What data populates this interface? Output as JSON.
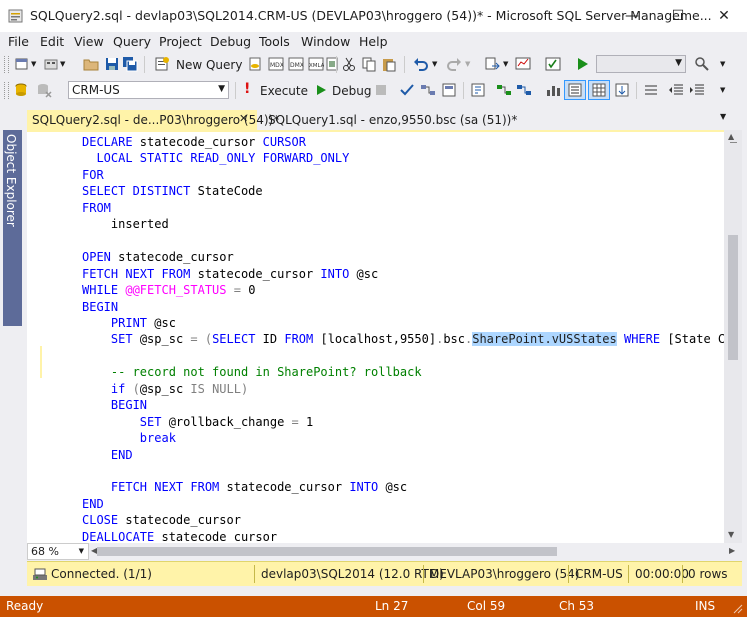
{
  "window": {
    "title": "SQLQuery2.sql - devlap03\\SQL2014.CRM-US (DEVLAP03\\hroggero (54))* - Microsoft SQL Server Manageme..."
  },
  "menu": [
    "File",
    "Edit",
    "View",
    "Query",
    "Project",
    "Debug",
    "Tools",
    "Window",
    "Help"
  ],
  "toolbar1": {
    "new_query_label": "New Query"
  },
  "toolbar2": {
    "database": "CRM-US",
    "execute_label": "Execute",
    "debug_label": "Debug"
  },
  "tabs": [
    {
      "label": "SQLQuery2.sql - de...P03\\hroggero (54))*",
      "active": true
    },
    {
      "label": "SQLQuery1.sql - enzo,9550.bsc (sa (51))*",
      "active": false
    }
  ],
  "side_panel": {
    "label": "Object Explorer"
  },
  "code": [
    [
      [
        "kw",
        "DECLARE"
      ],
      [
        "tx",
        " statecode_cursor "
      ],
      [
        "kw",
        "CURSOR"
      ]
    ],
    [
      [
        "tx",
        "  "
      ],
      [
        "kw",
        "LOCAL STATIC READ_ONLY FORWARD_ONLY"
      ]
    ],
    [
      [
        "kw",
        "FOR"
      ]
    ],
    [
      [
        "kw",
        "SELECT DISTINCT"
      ],
      [
        "tx",
        " StateCode"
      ]
    ],
    [
      [
        "kw",
        "FROM"
      ]
    ],
    [
      [
        "tx",
        "    inserted"
      ]
    ],
    [
      [
        "tx",
        ""
      ]
    ],
    [
      [
        "kw",
        "OPEN"
      ],
      [
        "tx",
        " statecode_cursor"
      ]
    ],
    [
      [
        "kw",
        "FETCH NEXT FROM"
      ],
      [
        "tx",
        " statecode_cursor "
      ],
      [
        "kw",
        "INTO"
      ],
      [
        "tx",
        " @sc"
      ]
    ],
    [
      [
        "kw",
        "WHILE"
      ],
      [
        "tx",
        " "
      ],
      [
        "mg",
        "@@FETCH_STATUS"
      ],
      [
        "tx",
        " "
      ],
      [
        "gy",
        "="
      ],
      [
        "tx",
        " 0"
      ]
    ],
    [
      [
        "kw",
        "BEGIN"
      ]
    ],
    [
      [
        "tx",
        "    "
      ],
      [
        "kw",
        "PRINT"
      ],
      [
        "tx",
        " @sc"
      ]
    ],
    [
      [
        "tx",
        "    "
      ],
      [
        "kw",
        "SET"
      ],
      [
        "tx",
        " @sp_sc "
      ],
      [
        "gy",
        "= ("
      ],
      [
        "kw",
        "SELECT"
      ],
      [
        "tx",
        " ID "
      ],
      [
        "kw",
        "FROM"
      ],
      [
        "tx",
        " [localhost,9550]"
      ],
      [
        "gy",
        "."
      ],
      [
        "tx",
        "bsc"
      ],
      [
        "gy",
        "."
      ],
      [
        "hl",
        "SharePoint.vUSStates"
      ],
      [
        "tx",
        " "
      ],
      [
        "kw",
        "WHERE"
      ],
      [
        "tx",
        " [State Co"
      ]
    ],
    [
      [
        "tx",
        ""
      ]
    ],
    [
      [
        "tx",
        "    "
      ],
      [
        "cm",
        "-- record not found in SharePoint? rollback"
      ]
    ],
    [
      [
        "tx",
        "    "
      ],
      [
        "kw",
        "if"
      ],
      [
        "tx",
        " "
      ],
      [
        "gy",
        "("
      ],
      [
        "tx",
        "@sp_sc "
      ],
      [
        "gy",
        "IS NULL)"
      ]
    ],
    [
      [
        "tx",
        "    "
      ],
      [
        "kw",
        "BEGIN"
      ]
    ],
    [
      [
        "tx",
        "        "
      ],
      [
        "kw",
        "SET"
      ],
      [
        "tx",
        " @rollback_change "
      ],
      [
        "gy",
        "="
      ],
      [
        "tx",
        " 1"
      ]
    ],
    [
      [
        "tx",
        "        "
      ],
      [
        "kw",
        "break"
      ]
    ],
    [
      [
        "tx",
        "    "
      ],
      [
        "kw",
        "END"
      ]
    ],
    [
      [
        "tx",
        ""
      ]
    ],
    [
      [
        "tx",
        "    "
      ],
      [
        "kw",
        "FETCH NEXT FROM"
      ],
      [
        "tx",
        " statecode_cursor "
      ],
      [
        "kw",
        "INTO"
      ],
      [
        "tx",
        " @sc"
      ]
    ],
    [
      [
        "kw",
        "END"
      ]
    ],
    [
      [
        "kw",
        "CLOSE"
      ],
      [
        "tx",
        " statecode_cursor"
      ]
    ],
    [
      [
        "kw",
        "DEALLOCATE"
      ],
      [
        "tx",
        " statecode_cursor"
      ]
    ]
  ],
  "zoom": "68 %",
  "query_status": {
    "connection": "Connected. (1/1)",
    "server": "devlap03\\SQL2014 (12.0 RTM)",
    "user": "DEVLAP03\\hroggero (54)",
    "database": "CRM-US",
    "elapsed": "00:00:00",
    "rows": "0 rows"
  },
  "status": {
    "state": "Ready",
    "line": "Ln 27",
    "col": "Col 59",
    "ch": "Ch 53",
    "mode": "INS"
  },
  "colors": {
    "status_bar": "#ca5100",
    "query_status": "#fff3a9",
    "keyword": "#0000ff",
    "comment": "#008000",
    "system_var": "#ff00ff",
    "operator": "#808080",
    "selection": "#add6ff"
  }
}
